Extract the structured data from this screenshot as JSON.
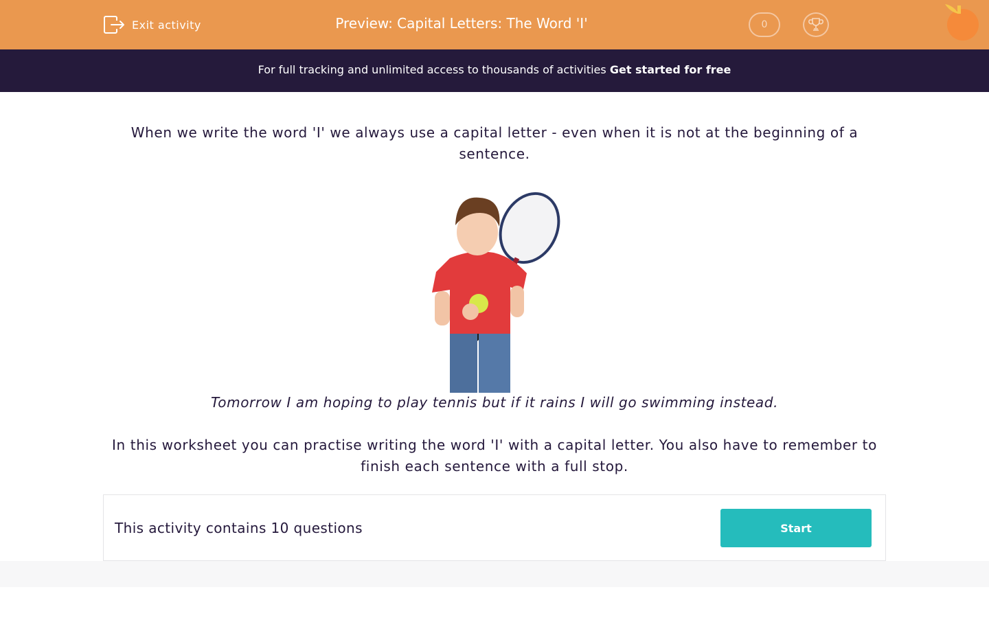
{
  "header": {
    "exit_label": "Exit activity",
    "title": "Preview: Capital Letters: The Word 'I'",
    "score": "0",
    "icons": [
      "exit-icon",
      "trophy-icon",
      "orange-logo-icon"
    ]
  },
  "banner": {
    "text": "For full tracking and unlimited access to thousands of activities ",
    "link": "Get started for free"
  },
  "content": {
    "intro": "When we write the word 'I' we always use a capital letter - even when it is not at the beginning of a sentence.",
    "example": "Tomorrow I am hoping to play tennis but if it rains I will go swimming instead.",
    "explanation": "In this worksheet you can practise writing the word 'I' with a capital letter. You also have to remember to finish each sentence with a full stop.",
    "image_subject": "child holding tennis racket and ball"
  },
  "activity": {
    "summary": "This activity contains 10 questions",
    "start_label": "Start"
  },
  "colors": {
    "header_bg": "#ea984f",
    "banner_bg": "#251a3b",
    "text": "#24183b",
    "button_bg": "#25bcbc"
  }
}
